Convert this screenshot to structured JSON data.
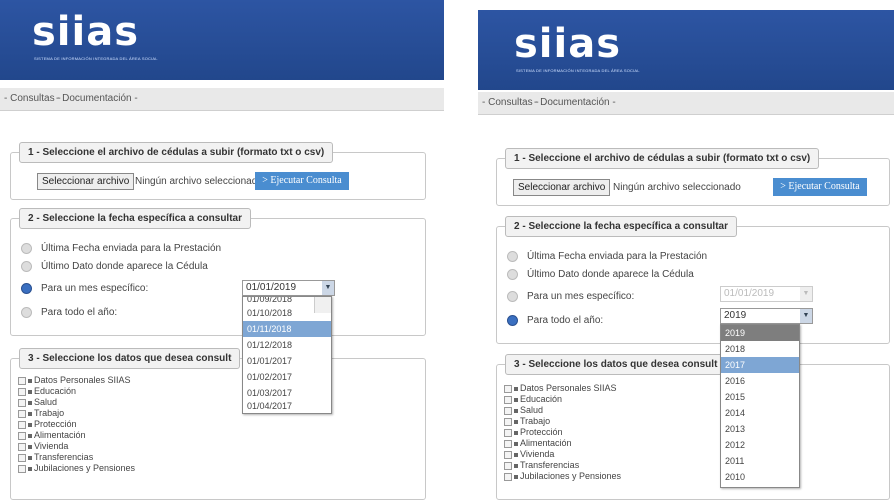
{
  "header": {
    "logo_text": "siias",
    "logo_subtitle": "SISTEMA DE INFORMACIÓN INTEGRADA DEL ÁREA SOCIAL"
  },
  "nav": {
    "consultas": "- Consultas -",
    "documentacion": "- Documentación -"
  },
  "section1": {
    "legend": "1 - Seleccione el archivo de cédulas a subir (formato txt o csv)",
    "file_button": "Seleccionar archivo",
    "file_status": "Ningún archivo seleccionado",
    "execute_button": "> Ejecutar Consulta"
  },
  "section2": {
    "legend": "2 - Seleccione la fecha específica a consultar",
    "options": [
      "Última Fecha enviada para la Prestación",
      "Último Dato donde aparece la Cédula",
      "Para un mes específico:",
      "Para todo el año:"
    ]
  },
  "section3": {
    "legend_left": "3 - Seleccione los datos que desea consult",
    "legend_right": "3 - Seleccione los datos que desea consult",
    "items": [
      "Datos Personales SIIAS",
      "Educación",
      "Salud",
      "Trabajo",
      "Protección",
      "Alimentación",
      "Vivienda",
      "Transferencias",
      "Jubilaciones y Pensiones"
    ]
  },
  "left_panel": {
    "month_select_value": "01/01/2019",
    "month_dropdown": [
      "01/09/2018",
      "01/10/2018",
      "01/11/2018",
      "01/12/2018",
      "01/01/2017",
      "01/02/2017",
      "01/03/2017",
      "01/04/2017"
    ],
    "month_highlighted": "01/11/2018"
  },
  "right_panel": {
    "month_select_value": "01/01/2019",
    "year_select_value": "2019",
    "year_dropdown": [
      "2019",
      "2018",
      "2017",
      "2016",
      "2015",
      "2014",
      "2013",
      "2012",
      "2011",
      "2010"
    ],
    "year_selected": "2019",
    "year_highlighted": "2017"
  },
  "colors": {
    "header_blue": "#2a4f98",
    "button_blue": "#4a8dd0",
    "radio_on": "#3a6fc0",
    "highlight": "#7ea6d4"
  }
}
